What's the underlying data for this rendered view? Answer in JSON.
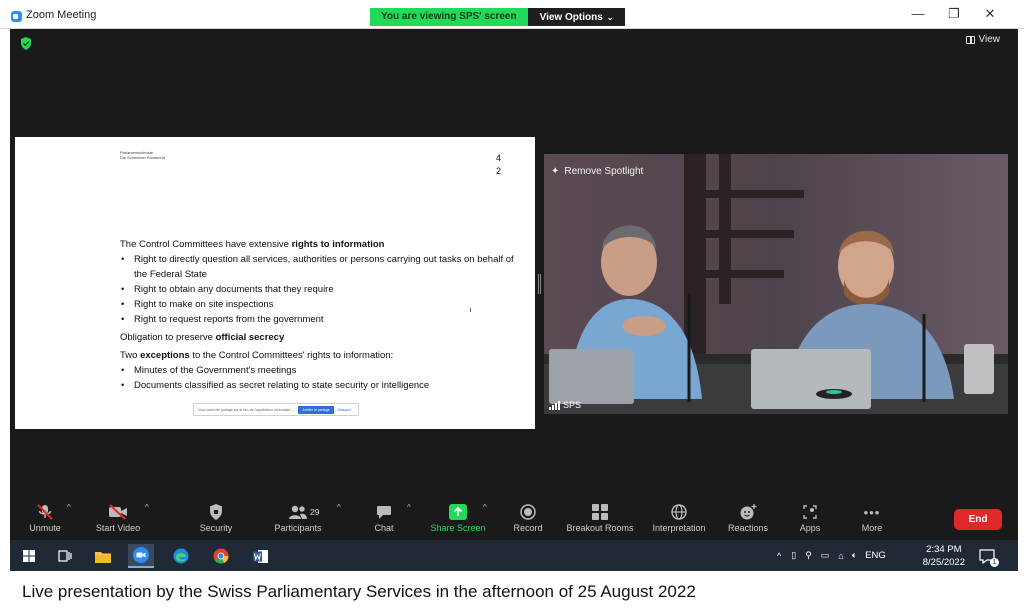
{
  "window": {
    "title": "Zoom Meeting",
    "banner_text": "You are viewing SPS' screen",
    "view_options_label": "View Options",
    "view_button_label": "View",
    "accent": "#23d959"
  },
  "slide": {
    "org_line1": "Parlamentsdienste",
    "org_line2": "Die Schweizer Parlament",
    "page_digit1": "4",
    "page_digit2": "2",
    "heading_plain": "The Control Committees have extensive ",
    "heading_bold": "rights to information",
    "bullets_1": [
      "Right to directly question all services, authorities or persons carrying out tasks on behalf of the Federal State",
      "Right to obtain any documents that they require",
      "Right to make on site inspections",
      "Right to request reports from the government"
    ],
    "secrecy_plain": "Obligation to preserve ",
    "secrecy_bold": "official secrecy",
    "exceptions_plain1": "Two ",
    "exceptions_bold": "exceptions",
    "exceptions_plain2": " to the Control Committees' rights to information:",
    "bullets_2": [
      "Minutes of the Government's meetings",
      "Documents classified as secret relating to state security or intelligence"
    ],
    "toast_text": "Vous avez été partagé sur le lieu de l'application véhiculaire ...",
    "toast_button": "Arrêter le partage",
    "toast_dismiss": "Masquer"
  },
  "camera": {
    "spotlight_label": "Remove Spotlight",
    "participant_name": "SPS"
  },
  "toolbar": {
    "items": [
      {
        "label": "Unmute",
        "icon": "muted-mic-icon"
      },
      {
        "label": "Start Video",
        "icon": "video-off-icon"
      },
      {
        "label": "Security",
        "icon": "shield-icon"
      },
      {
        "label": "Participants",
        "icon": "participants-icon"
      },
      {
        "label": "Chat",
        "icon": "chat-icon"
      },
      {
        "label": "Share Screen",
        "icon": "share-screen-icon"
      },
      {
        "label": "Record",
        "icon": "record-icon"
      },
      {
        "label": "Breakout Rooms",
        "icon": "breakout-rooms-icon"
      },
      {
        "label": "Interpretation",
        "icon": "globe-icon"
      },
      {
        "label": "Reactions",
        "icon": "reactions-icon"
      },
      {
        "label": "Apps",
        "icon": "apps-icon"
      },
      {
        "label": "More",
        "icon": "more-icon"
      }
    ],
    "participant_count": "29",
    "end_label": "End"
  },
  "taskbar": {
    "language": "ENG",
    "time": "2:34 PM",
    "date": "8/25/2022",
    "notification_count": "1"
  },
  "caption": "Live presentation by the Swiss Parliamentary Services in the afternoon of 25 August 2022"
}
